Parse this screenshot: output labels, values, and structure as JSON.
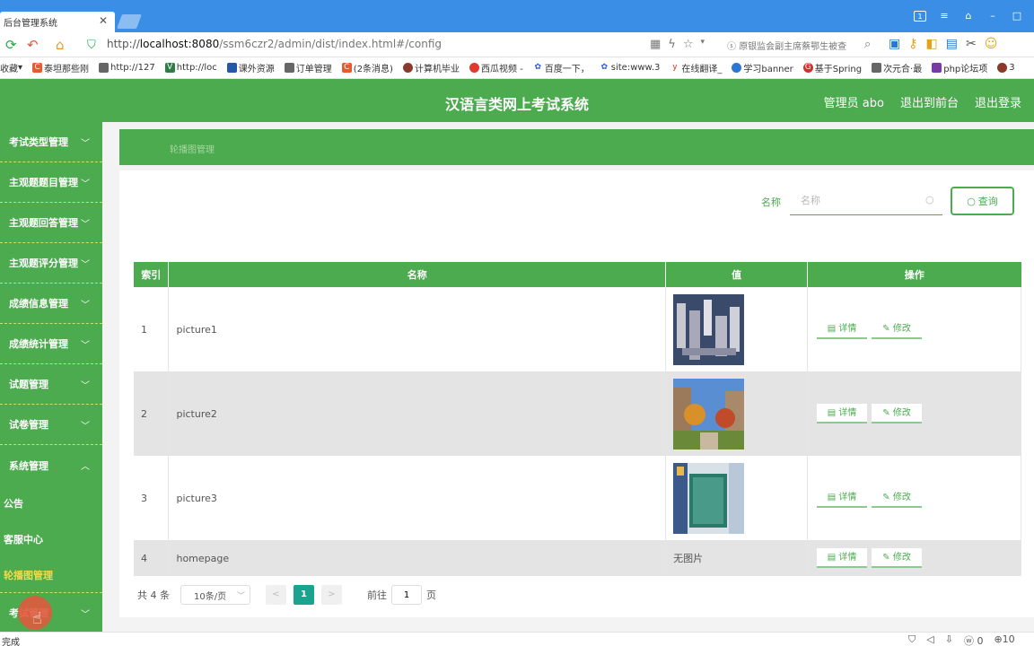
{
  "browser": {
    "tab_title": "后台管理系统",
    "tab_close": "✕",
    "url_prefix": "http://",
    "url_host": "localhost:8080",
    "url_path": "/ssm6czr2/admin/dist/index.html#/config",
    "search_hint": "原银监会副主席蔡鄂生被查",
    "bookmarks": [
      "收藏",
      "泰坦那些刚",
      "http://127",
      "http://loc",
      "课外资源",
      "订单管理",
      "(2条消息)",
      "计算机毕业",
      "西瓜视频 -",
      "百度一下，",
      "site:www.3",
      "在线翻译_",
      "学习banner",
      "基于Spring",
      "次元合·最",
      "php论坛项",
      "3"
    ],
    "status_text": "完成",
    "status_right": [
      "0",
      "10"
    ]
  },
  "header": {
    "title": "汉语言类网上考试系统",
    "admin_label": "管理员 abo",
    "to_front": "退出到前台",
    "logout": "退出登录"
  },
  "sidebar": {
    "items": [
      {
        "label": "考试类型管理",
        "chev": "﹀"
      },
      {
        "label": "主观题题目管理",
        "chev": "﹀"
      },
      {
        "label": "主观题回答管理",
        "chev": "﹀"
      },
      {
        "label": "主观题评分管理",
        "chev": "﹀"
      },
      {
        "label": "成绩信息管理",
        "chev": "﹀"
      },
      {
        "label": "成绩统计管理",
        "chev": "﹀"
      },
      {
        "label": "试题管理",
        "chev": "﹀"
      },
      {
        "label": "试卷管理",
        "chev": "﹀"
      },
      {
        "label": "系统管理",
        "chev": "︿"
      }
    ],
    "sub_items": [
      "公告",
      "客服中心",
      "轮播图管理"
    ],
    "last_item": {
      "label": "考试管理",
      "chev": "﹀"
    }
  },
  "breadcrumb": "轮播图管理",
  "search": {
    "label": "名称",
    "placeholder": "名称",
    "button": "查询"
  },
  "table": {
    "headers": [
      "索引",
      "名称",
      "值",
      "操作"
    ],
    "rows": [
      {
        "index": "1",
        "name": "picture1",
        "value": ""
      },
      {
        "index": "2",
        "name": "picture2",
        "value": ""
      },
      {
        "index": "3",
        "name": "picture3",
        "value": ""
      },
      {
        "index": "4",
        "name": "homepage",
        "value": "无图片"
      }
    ],
    "detail_label": "详情",
    "edit_label": "修改"
  },
  "pagination": {
    "total": "共 4 条",
    "page_size": "10条/页",
    "prev": "<",
    "current": "1",
    "next": ">",
    "goto_label": "前往",
    "goto_value": "1",
    "page_unit": "页"
  }
}
